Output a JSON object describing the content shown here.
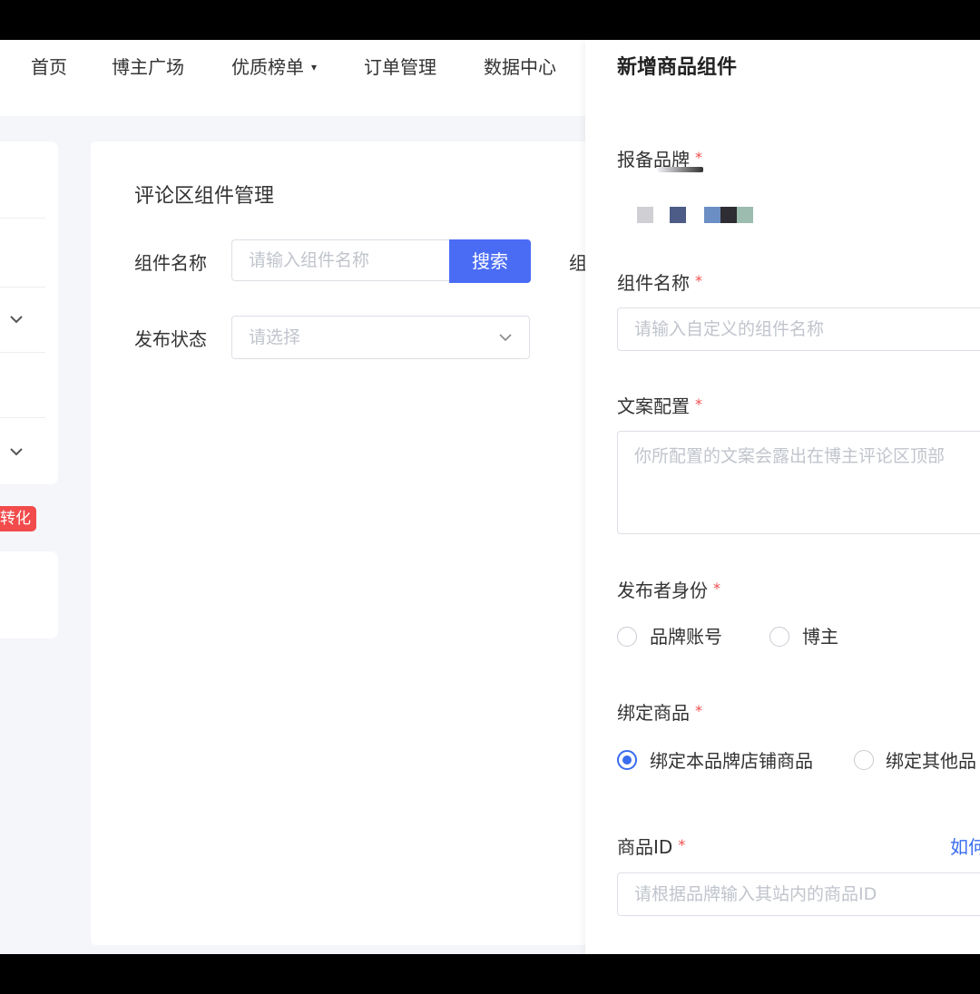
{
  "nav": {
    "items": [
      "首页",
      "博主广场",
      "优质榜单",
      "订单管理",
      "数据中心"
    ],
    "dropdown_caret": "▾"
  },
  "sidebar": {
    "tag": "转化"
  },
  "main": {
    "title": "评论区组件管理",
    "name_label": "组件名称",
    "name_placeholder": "请输入组件名称",
    "search_button": "搜索",
    "clipped_label": "组",
    "status_label": "发布状态",
    "status_placeholder": "请选择"
  },
  "drawer": {
    "title": "新增商品组件",
    "brand_label": "报备品牌",
    "component_name_label": "组件名称",
    "component_name_placeholder": "请输入自定义的组件名称",
    "copy_label": "文案配置",
    "copy_placeholder": "你所配置的文案会露出在博主评论区顶部",
    "publisher_label": "发布者身份",
    "publisher_options": [
      "品牌账号",
      "博主"
    ],
    "bind_label": "绑定商品",
    "bind_options": [
      "绑定本品牌店铺商品",
      "绑定其他品"
    ],
    "product_id_label": "商品ID",
    "product_id_help": "如何",
    "product_id_placeholder": "请根据品牌输入其站内的商品ID",
    "required_mark": "*"
  },
  "colors": {
    "primary": "#4a6cf5",
    "required": "#f04c4c",
    "tag": "#f24b4b"
  }
}
